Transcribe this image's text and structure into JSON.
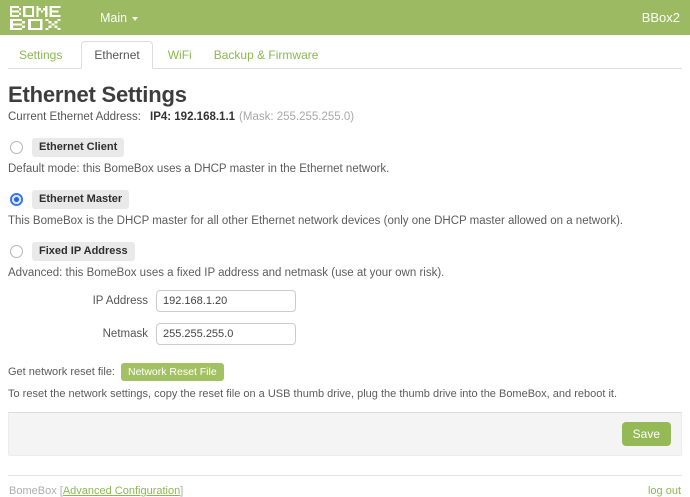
{
  "header": {
    "logo_line1": "BOME",
    "logo_line2": "BOX",
    "logo_text": "BOMEBOX",
    "menu_label": "Main",
    "device_name": "BBox2"
  },
  "tabs": [
    {
      "label": "Settings",
      "active": false
    },
    {
      "label": "Ethernet",
      "active": true
    },
    {
      "label": "WiFi",
      "active": false
    },
    {
      "label": "Backup & Firmware",
      "active": false
    }
  ],
  "page": {
    "title": "Ethernet Settings",
    "current_address_label": "Current Ethernet Address:",
    "current_address_value": "IP4: 192.168.1.1",
    "current_address_mask": "(Mask: 255.255.255.0)"
  },
  "options": [
    {
      "label": "Ethernet Client",
      "selected": false,
      "description": "Default mode: this BomeBox uses a DHCP master in the Ethernet network."
    },
    {
      "label": "Ethernet Master",
      "selected": true,
      "description": "This BomeBox is the DHCP master for all other Ethernet network devices (only one DHCP master allowed on a network)."
    },
    {
      "label": "Fixed IP Address",
      "selected": false,
      "description": "Advanced: this BomeBox uses a fixed IP address and netmask (use at your own risk)."
    }
  ],
  "form": {
    "ip_label": "IP Address",
    "ip_value": "192.168.1.20",
    "netmask_label": "Netmask",
    "netmask_value": "255.255.255.0"
  },
  "reset": {
    "prompt": "Get network reset file:",
    "button_label": "Network Reset File",
    "instructions": "To reset the network settings, copy the reset file on a USB thumb drive, plug the thumb drive into the BomeBox, and reboot it."
  },
  "actions": {
    "save_label": "Save"
  },
  "footer": {
    "brand": "BomeBox",
    "bracket_open": "[",
    "advanced_link": "Advanced Configuration",
    "bracket_close": "]",
    "logout": "log out"
  },
  "colors": {
    "header_green": "#9cba62",
    "link_green": "#8cb850",
    "button_green": "#94b956",
    "chip_green": "#a2c162",
    "radio_blue": "#3576f5"
  }
}
